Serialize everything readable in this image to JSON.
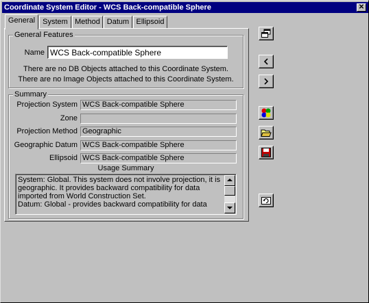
{
  "window": {
    "title": "Coordinate System Editor - WCS Back-compatible Sphere",
    "close_glyph": "✕"
  },
  "tabs": [
    {
      "label": "General",
      "active": true
    },
    {
      "label": "System",
      "active": false
    },
    {
      "label": "Method",
      "active": false
    },
    {
      "label": "Datum",
      "active": false
    },
    {
      "label": "Ellipsoid",
      "active": false
    }
  ],
  "general_features": {
    "group_label": "General Features",
    "name_label": "Name",
    "name_value": "WCS Back-compatible Sphere",
    "info_db": "There are no DB Objects attached to this Coordinate System.",
    "info_image": "There are no Image Objects attached to this Coordinate System."
  },
  "summary": {
    "group_label": "Summary",
    "fields": [
      {
        "label": "Projection System",
        "value": "WCS Back-compatible Sphere"
      },
      {
        "label": "Zone",
        "value": ""
      },
      {
        "label": "Projection Method",
        "value": "Geographic"
      },
      {
        "label": "Geographic Datum",
        "value": "WCS Back-compatible Sphere"
      },
      {
        "label": "Ellipsoid",
        "value": "WCS Back-compatible Sphere"
      }
    ],
    "usage_label": "Usage Summary",
    "usage_text": "System: Global. This system does not involve projection, it is geographic. It provides backward compatibility for data imported from World Construction Set.\nDatum: Global - provides backward compatibility for data"
  },
  "toolbar": [
    {
      "icon": "clone-windows-icon"
    },
    {
      "icon": "arrow-left-icon"
    },
    {
      "icon": "arrow-right-icon"
    },
    {
      "icon": "palette-icon"
    },
    {
      "icon": "open-folder-icon"
    },
    {
      "icon": "save-disk-icon"
    },
    {
      "icon": "reload-icon"
    }
  ],
  "colors": {
    "titlebar": "#000080",
    "face": "#c0c0c0",
    "save_red": "#c00000"
  }
}
